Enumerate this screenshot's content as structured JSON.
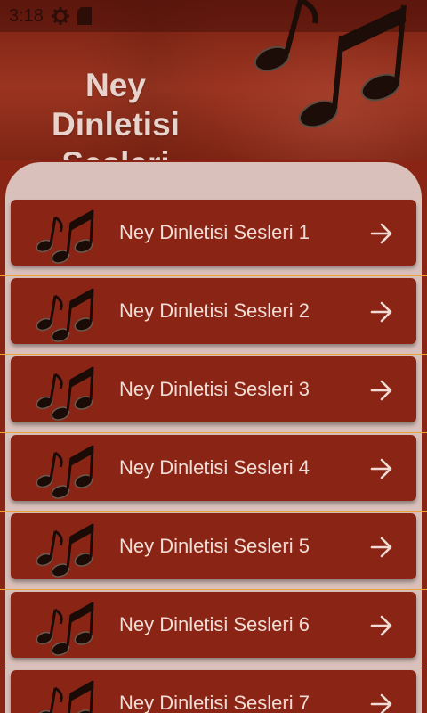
{
  "status_bar": {
    "time": "3:18",
    "icons": [
      "settings-icon",
      "sd-card-icon"
    ]
  },
  "header": {
    "title": "Ney Dinletisi Sesleri",
    "decoration": "music-notes-icon"
  },
  "colors": {
    "primary": "#8a2414",
    "panel": "#d9c0bb",
    "divider": "#f0a23a",
    "text": "#f0dcd6"
  },
  "items": [
    {
      "label": "Ney Dinletisi Sesleri 1",
      "icon": "music-note-icon",
      "action": "arrow-right-icon"
    },
    {
      "label": "Ney Dinletisi Sesleri 2",
      "icon": "music-note-icon",
      "action": "arrow-right-icon"
    },
    {
      "label": "Ney Dinletisi Sesleri 3",
      "icon": "music-note-icon",
      "action": "arrow-right-icon"
    },
    {
      "label": "Ney Dinletisi Sesleri 4",
      "icon": "music-note-icon",
      "action": "arrow-right-icon"
    },
    {
      "label": "Ney Dinletisi Sesleri 5",
      "icon": "music-note-icon",
      "action": "arrow-right-icon"
    },
    {
      "label": "Ney Dinletisi Sesleri 6",
      "icon": "music-note-icon",
      "action": "arrow-right-icon"
    },
    {
      "label": "Ney Dinletisi Sesleri 7",
      "icon": "music-note-icon",
      "action": "arrow-right-icon"
    }
  ]
}
